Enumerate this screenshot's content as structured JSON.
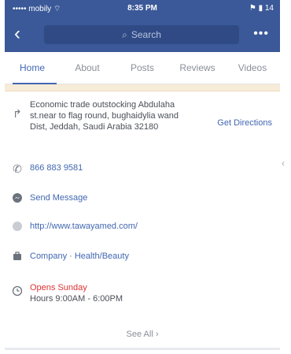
{
  "status": {
    "carrier": "••••• mobily ⌔",
    "time": "8:35 PM",
    "right": "⚑ ▮ 14"
  },
  "nav": {
    "back": "‹",
    "search_placeholder": "Search",
    "more": "•••"
  },
  "tabs": [
    {
      "label": "Home"
    },
    {
      "label": "About"
    },
    {
      "label": "Posts"
    },
    {
      "label": "Reviews"
    },
    {
      "label": "Videos"
    }
  ],
  "info": {
    "address": "Economic trade outstocking Abdulaha st.near to flag round, bughaidylia wand Dist, Jeddah, Saudi Arabia 32180",
    "directions": "Get Directions",
    "phone": "866 883 9581",
    "message": "Send Message",
    "website": "http://www.tawayamed.com/",
    "category": "Company · Health/Beauty",
    "hours_status": "Opens Sunday",
    "hours": "Hours 9:00AM - 6:00PM"
  },
  "see_all": "See All ›"
}
